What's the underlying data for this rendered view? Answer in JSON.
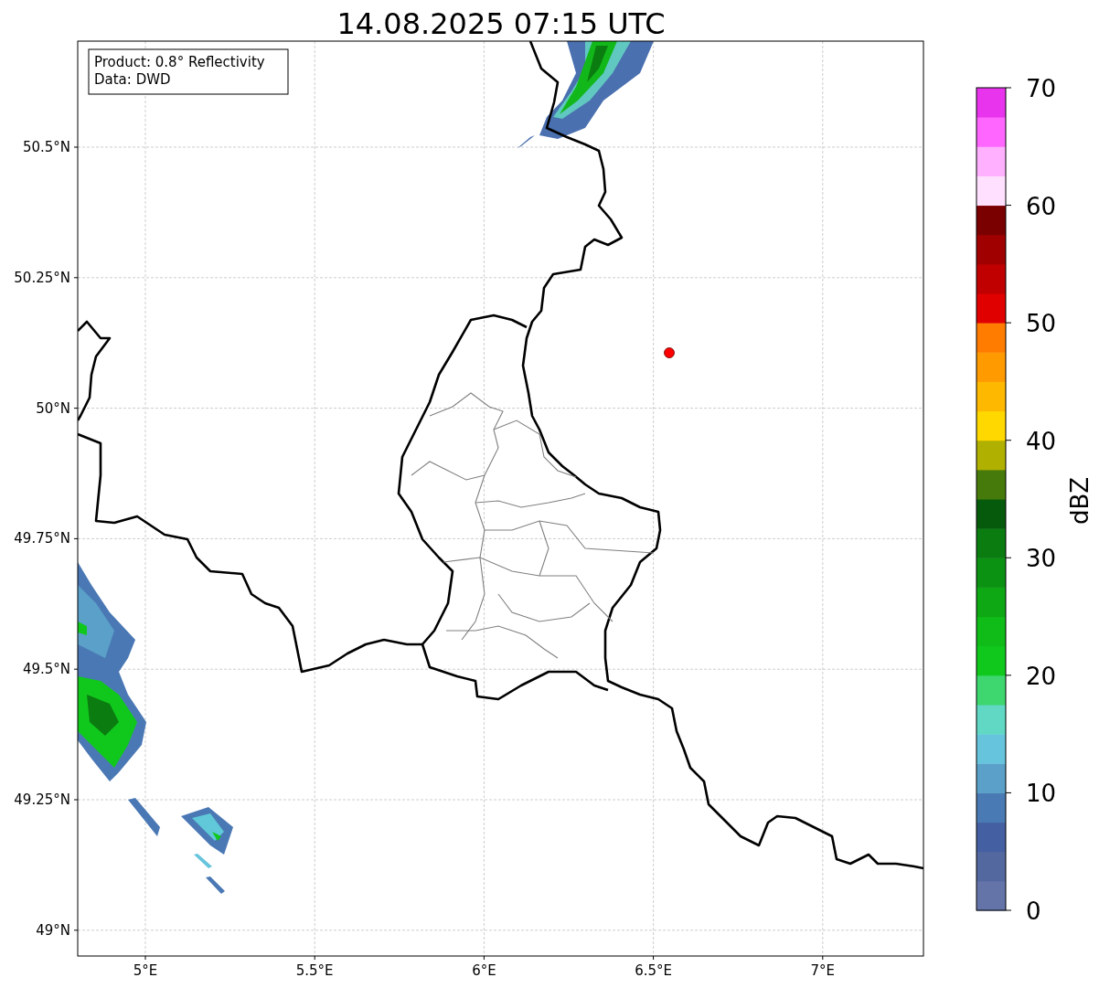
{
  "title": "14.08.2025 07:15 UTC",
  "info_box": {
    "lines": [
      "Product: 0.8° Reflectivity",
      "Data: DWD"
    ]
  },
  "map": {
    "lon_ticks": [
      "5°E",
      "5.5°E",
      "6°E",
      "6.5°E",
      "7°E"
    ],
    "lat_ticks": [
      "50.5°N",
      "50.25°N",
      "50°N",
      "49.75°N",
      "49.5°N",
      "49.25°N",
      "49°N"
    ]
  },
  "colorbar": {
    "label": "dBZ",
    "ticks": [
      "70",
      "60",
      "50",
      "40",
      "30",
      "20",
      "10",
      "0"
    ]
  }
}
